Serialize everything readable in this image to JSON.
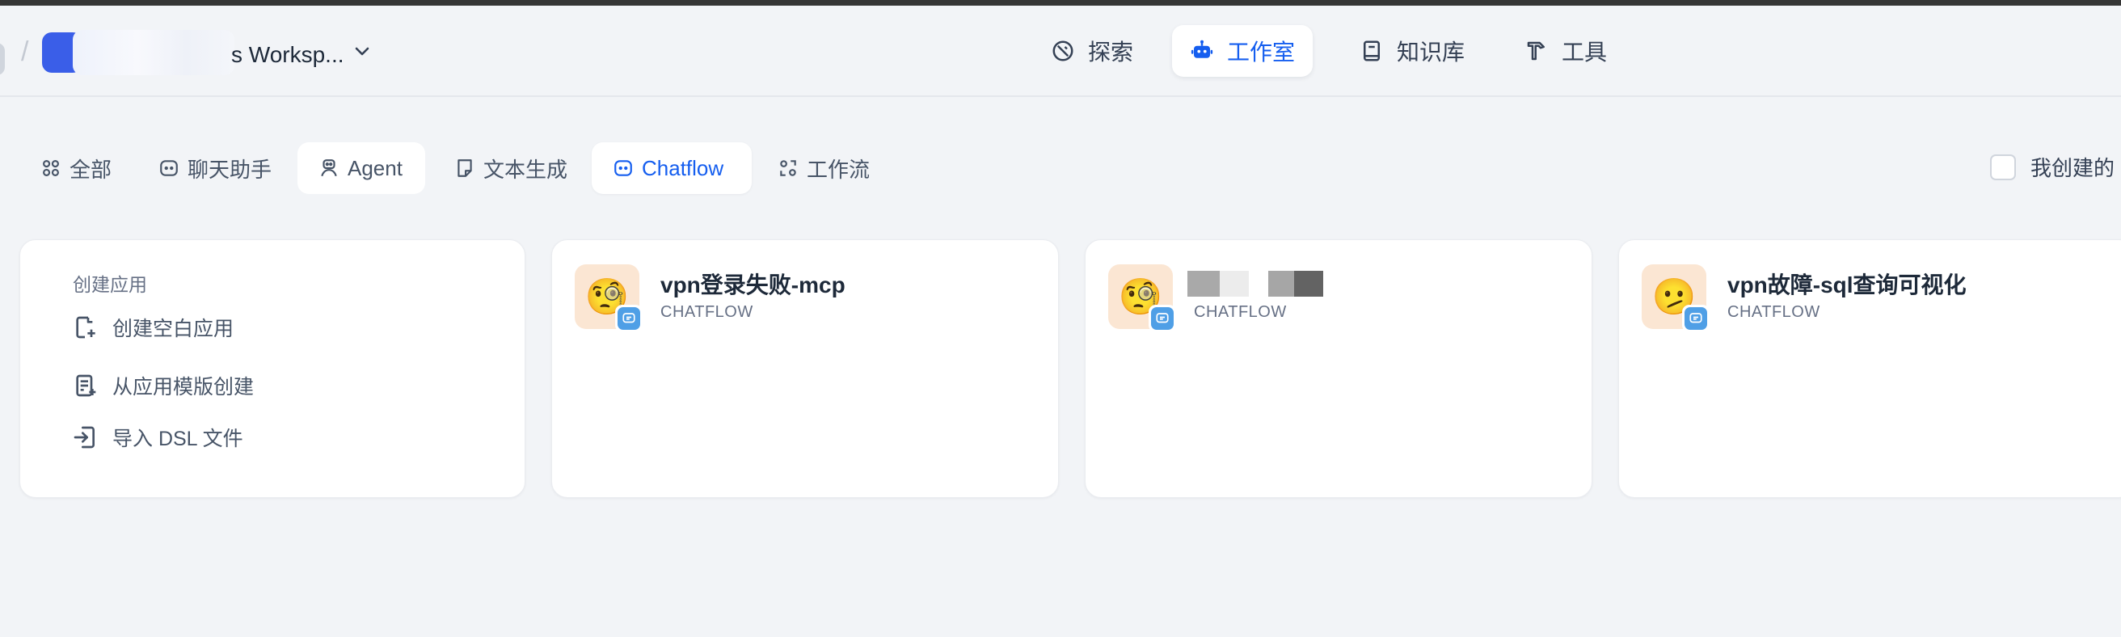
{
  "header": {
    "workspace_name": "s Worksp...",
    "nav": [
      {
        "label": "探索",
        "icon": "compass-icon"
      },
      {
        "label": "工作室",
        "icon": "robot-icon"
      },
      {
        "label": "知识库",
        "icon": "book-icon"
      },
      {
        "label": "工具",
        "icon": "hammer-icon"
      }
    ],
    "active_nav": "工作室",
    "accent": "#155eef"
  },
  "filters": {
    "tabs": [
      {
        "label": "全部",
        "icon": "grid-icon"
      },
      {
        "label": "聊天助手",
        "icon": "chat-icon"
      },
      {
        "label": "Agent",
        "icon": "agent-icon"
      },
      {
        "label": "文本生成",
        "icon": "document-icon"
      },
      {
        "label": "Chatflow",
        "icon": "chatflow-icon"
      },
      {
        "label": "工作流",
        "icon": "workflow-icon"
      }
    ],
    "active": "Chatflow",
    "mine_label": "我创建的",
    "mine_checked": false
  },
  "create": {
    "title": "创建应用",
    "items": [
      {
        "label": "创建空白应用",
        "icon": "file-plus-icon"
      },
      {
        "label": "从应用模版创建",
        "icon": "template-icon"
      },
      {
        "label": "导入 DSL 文件",
        "icon": "import-icon"
      }
    ]
  },
  "apps": [
    {
      "name": "vpn登录失败-mcp",
      "type": "CHATFLOW",
      "emoji": "🧐"
    },
    {
      "name": "",
      "type": "CHATFLOW",
      "emoji": "🧐"
    },
    {
      "name": "vpn故障-sql查询可视化",
      "type": "CHATFLOW",
      "emoji": "🫤"
    }
  ]
}
